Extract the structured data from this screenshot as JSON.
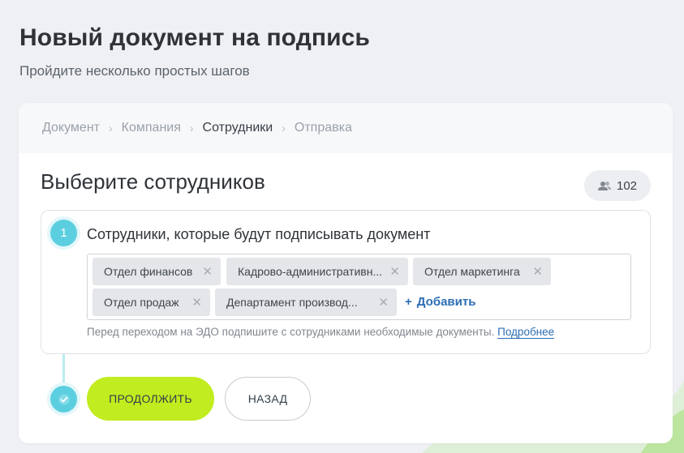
{
  "header": {
    "title": "Новый документ на подпись",
    "subtitle": "Пройдите несколько простых шагов"
  },
  "breadcrumb": {
    "items": [
      "Документ",
      "Компания",
      "Сотрудники",
      "Отправка"
    ],
    "active_index": 2
  },
  "section": {
    "title": "Выберите сотрудников",
    "employee_count": "102",
    "count_icon": "users-icon"
  },
  "step": {
    "number": "1",
    "label": "Сотрудники, которые будут подписывать документ",
    "tags": [
      "Отдел финансов",
      "Кадрово-административн...",
      "Отдел маркетинга",
      "Отдел продаж",
      "Департамент производ..."
    ],
    "add_label": "Добавить",
    "hint_text": "Перед переходом на ЭДО подпишите с сотрудниками необходимые документы.",
    "hint_link": "Подробнее"
  },
  "actions": {
    "continue_label": "ПРОДОЛЖИТЬ",
    "back_label": "НАЗАД"
  },
  "colors": {
    "accent_green": "#c1ec1f",
    "step_cyan": "#5bcfe0",
    "link_blue": "#2c6db4"
  }
}
